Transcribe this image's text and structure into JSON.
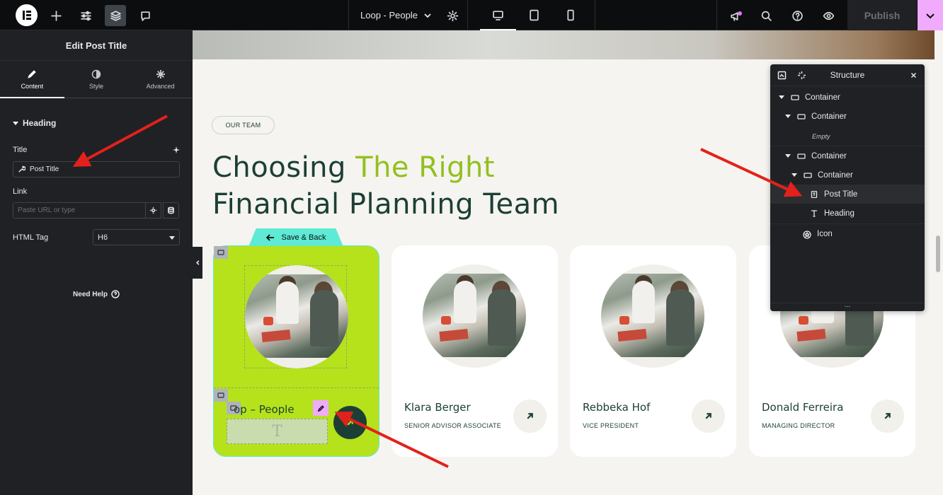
{
  "topbar": {
    "document_title": "Loop - People",
    "publish_label": "Publish"
  },
  "panel": {
    "title": "Edit Post Title",
    "tabs": [
      {
        "label": "Content",
        "icon": "pencil-icon"
      },
      {
        "label": "Style",
        "icon": "half-circle-icon"
      },
      {
        "label": "Advanced",
        "icon": "gear-icon"
      }
    ],
    "section_label": "Heading",
    "title_label": "Title",
    "title_value": "Post Title",
    "link_label": "Link",
    "link_placeholder": "Paste URL or type",
    "html_tag_label": "HTML Tag",
    "html_tag_value": "H6",
    "help_label": "Need Help"
  },
  "canvas": {
    "badge": "OUR TEAM",
    "headline_part1": "Choosing ",
    "headline_accent": "The Right",
    "headline_line2": "Financial Planning Team",
    "save_back_label": "Save & Back",
    "loop_title": "op – People",
    "cards": [
      {
        "name": "Klara Berger",
        "role": "SENIOR ADVISOR ASSOCIATE"
      },
      {
        "name": "Rebbeka Hof",
        "role": "VICE PRESIDENT"
      },
      {
        "name": "Donald Ferreira",
        "role": "MANAGING DIRECTOR"
      }
    ]
  },
  "structure": {
    "title": "Structure",
    "items": [
      {
        "label": "Container",
        "level": 0
      },
      {
        "label": "Container",
        "level": 1
      },
      {
        "label": "Empty",
        "level": 2
      },
      {
        "label": "Container",
        "level": 1
      },
      {
        "label": "Container",
        "level": 2
      },
      {
        "label": "Post Title",
        "level": 3
      },
      {
        "label": "Heading",
        "level": 3
      },
      {
        "label": "Icon",
        "level": 1
      }
    ]
  },
  "colors": {
    "accent_green": "#b5e21b",
    "dark_green": "#1c3f35",
    "highlight_green": "#93c01f",
    "pink": "#f0abfc",
    "teal": "#5eead4",
    "annotation_red": "#e3211c"
  }
}
